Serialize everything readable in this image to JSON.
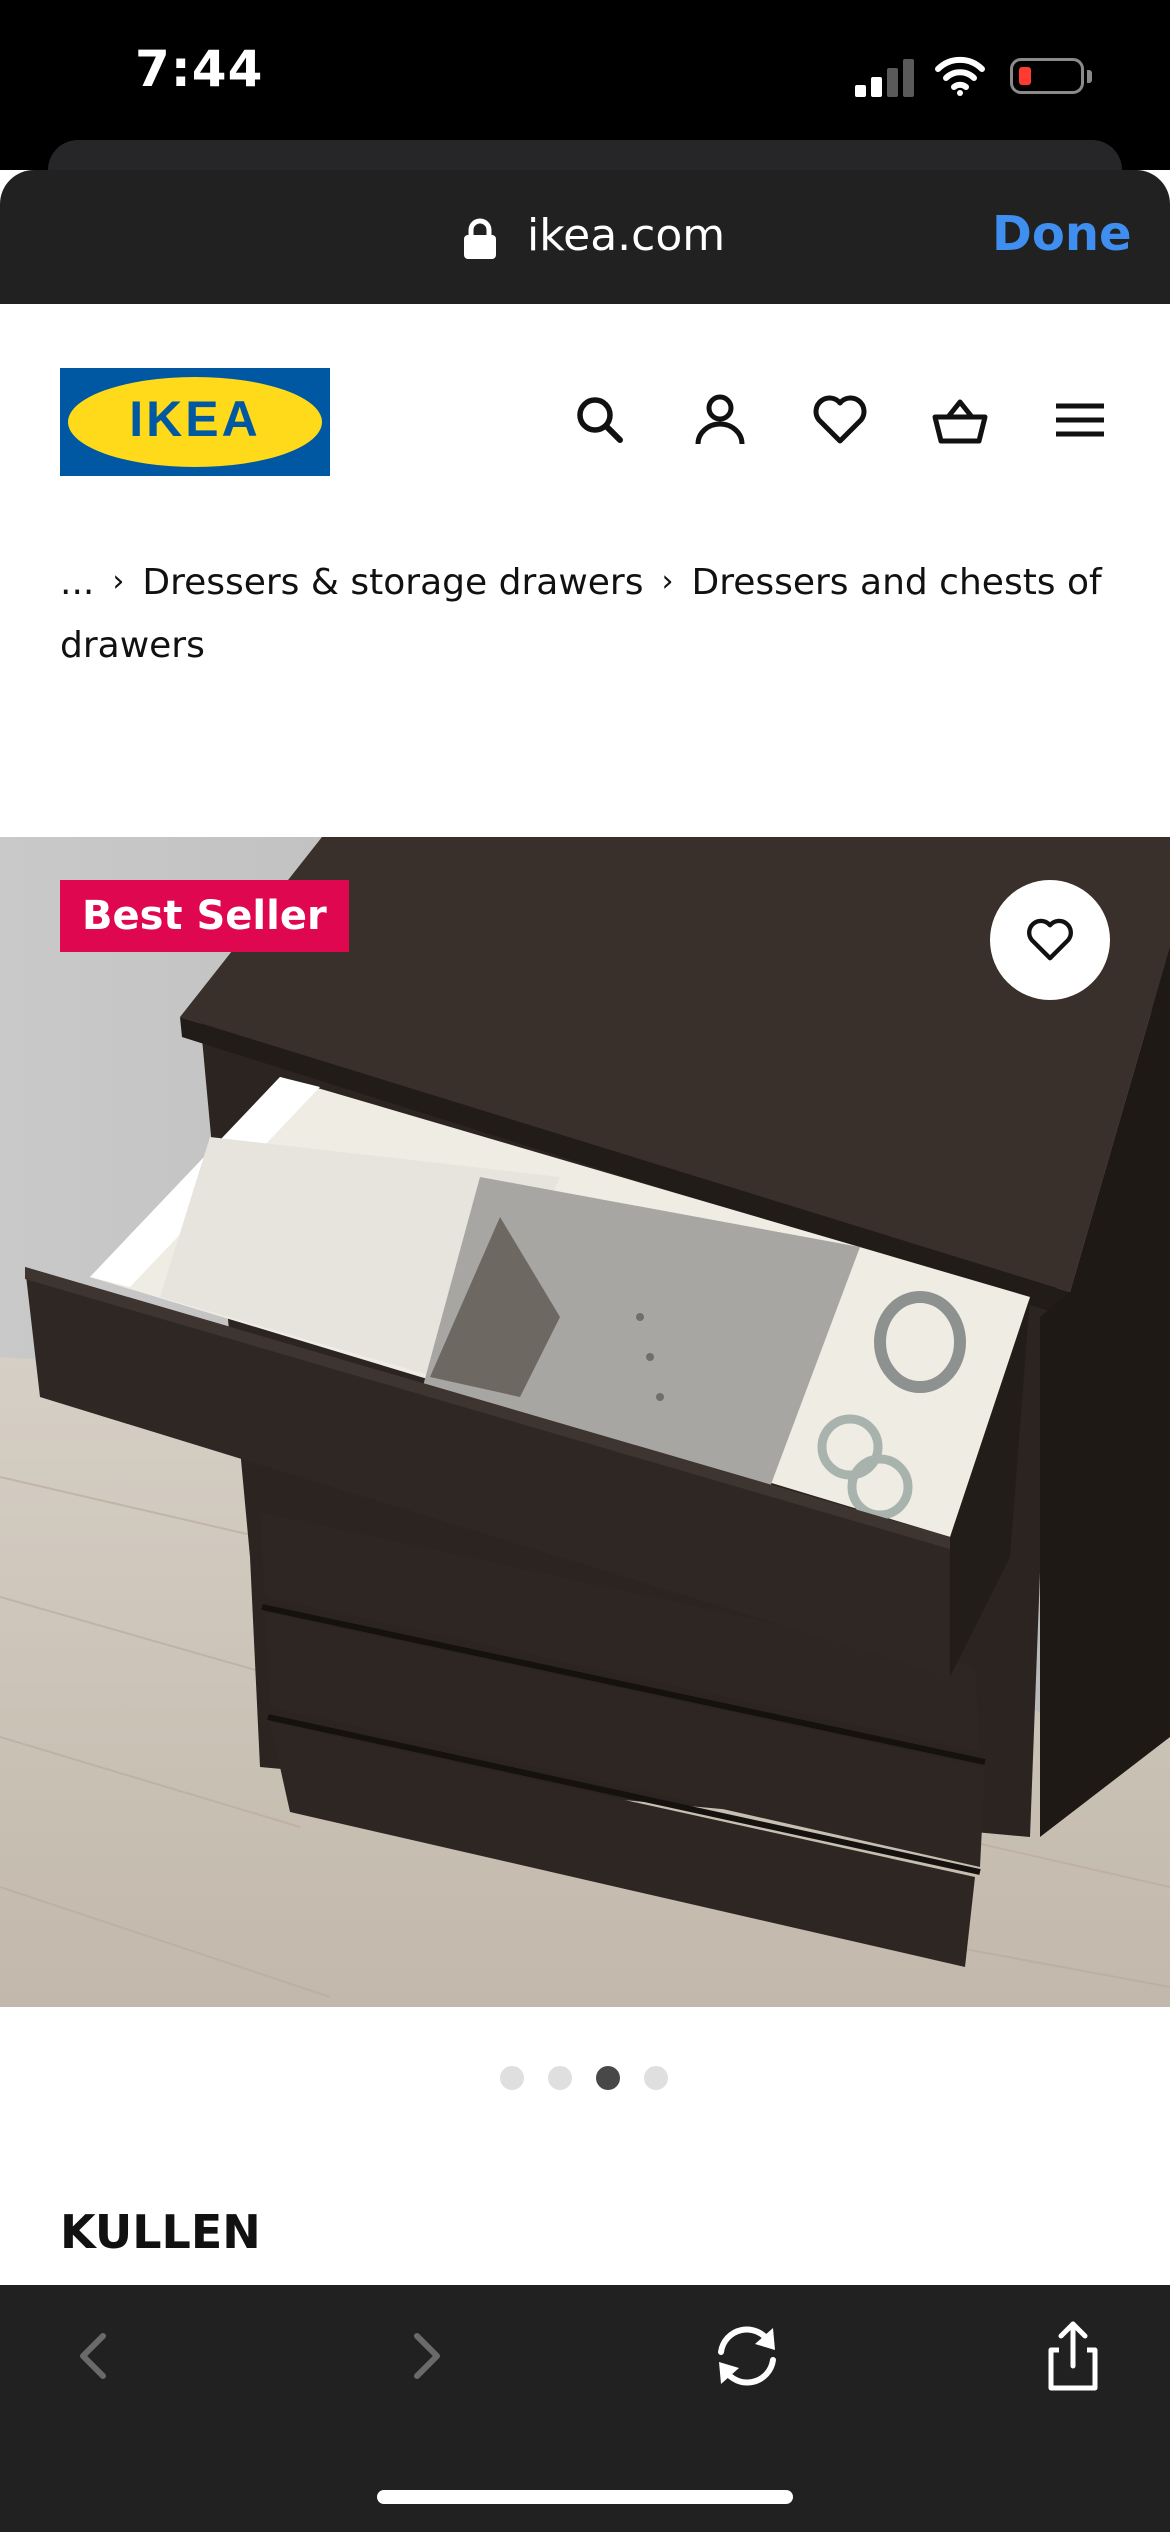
{
  "status_bar": {
    "time": "7:44"
  },
  "browser": {
    "url": "ikea.com",
    "done_label": "Done"
  },
  "header": {
    "logo_text": "IKEA",
    "icons": [
      "search-icon",
      "account-icon",
      "heart-icon",
      "basket-icon",
      "menu-icon"
    ]
  },
  "breadcrumb": {
    "items": [
      "...",
      "Dressers & storage drawers",
      "Dressers and chests of drawers"
    ],
    "separator": "›"
  },
  "product": {
    "badge": "Best Seller",
    "name": "KULLEN",
    "image_count": 4,
    "active_image_index": 2
  },
  "colors": {
    "accent_blue": "#3f8ff0",
    "ikea_blue": "#0058a3",
    "ikea_yellow": "#ffda1a",
    "badge_red": "#e00751",
    "dresser_brown": "#2e2622"
  }
}
